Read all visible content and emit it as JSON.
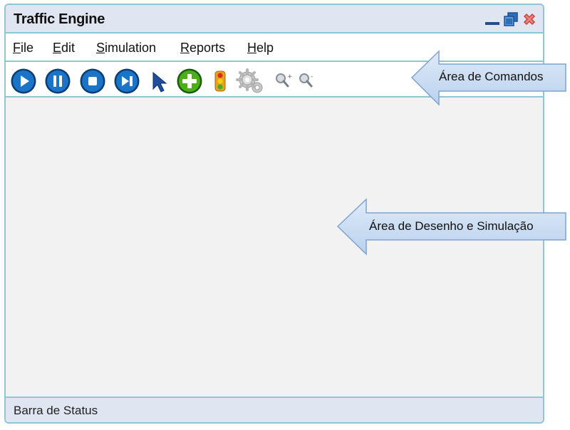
{
  "window": {
    "title": "Traffic Engine"
  },
  "menu": {
    "items": [
      {
        "label": "File"
      },
      {
        "label": "Edit"
      },
      {
        "label": "Simulation"
      },
      {
        "label": "Reports"
      },
      {
        "label": "Help"
      }
    ]
  },
  "toolbar": {
    "buttons": [
      {
        "icon": "play-icon"
      },
      {
        "icon": "pause-icon"
      },
      {
        "icon": "stop-icon"
      },
      {
        "icon": "step-forward-icon"
      },
      {
        "icon": "pointer-cursor-icon"
      },
      {
        "icon": "add-icon"
      },
      {
        "icon": "traffic-light-icon"
      },
      {
        "icon": "gears-icon"
      },
      {
        "icon": "zoom-in-icon"
      },
      {
        "icon": "zoom-out-icon"
      }
    ]
  },
  "callouts": {
    "commands": "Área de Comandos",
    "drawing": "Área de Desenho e Simulação"
  },
  "status": {
    "text": "Barra de Status"
  },
  "colors": {
    "window_border": "#8fc6d6",
    "titlebar": "#dfe6f2",
    "canvas": "#f2f2f2",
    "button_blue": "#1a75c9",
    "add_green": "#4caf1a",
    "close_red": "#d9534f",
    "callout_fill": "#c7dbf3"
  }
}
